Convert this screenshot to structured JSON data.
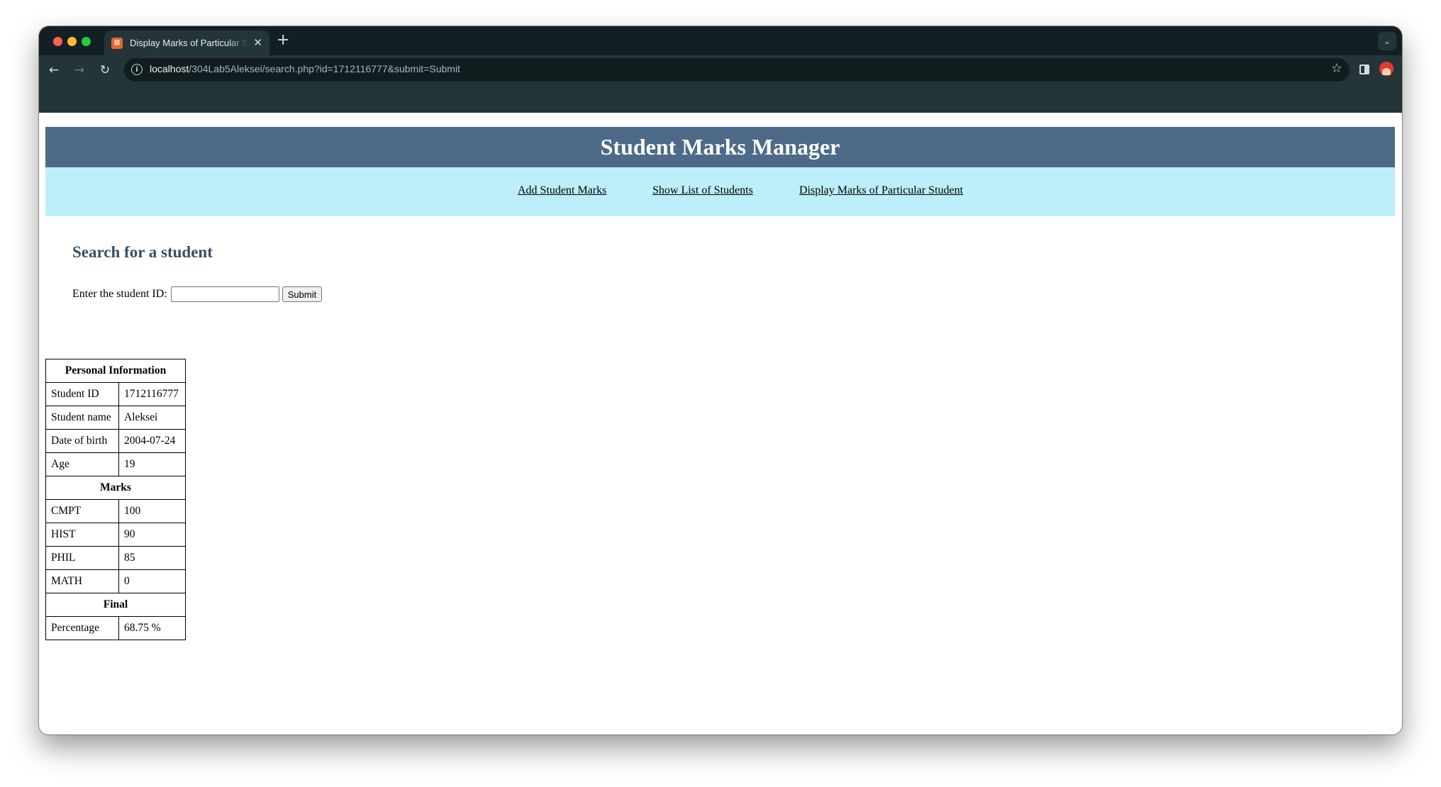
{
  "browser": {
    "tab_title": "Display Marks of Particular Student",
    "tab_favicon_glyph": "⊠",
    "url_host": "localhost",
    "url_path": "/304Lab5Aleksei/search.php?id=1712116777&submit=Submit"
  },
  "page": {
    "site_title": "Student Marks Manager",
    "nav": {
      "add": "Add Student Marks",
      "list": "Show List of Students",
      "display": "Display Marks of Particular Student"
    },
    "search": {
      "heading": "Search for a student",
      "label": "Enter the student ID:",
      "input_value": "",
      "submit_label": "Submit"
    },
    "table": {
      "personal_header": "Personal Information",
      "personal_rows": [
        {
          "label": "Student ID",
          "value": "1712116777"
        },
        {
          "label": "Student name",
          "value": "Aleksei"
        },
        {
          "label": "Date of birth",
          "value": "2004-07-24"
        },
        {
          "label": "Age",
          "value": "19"
        }
      ],
      "marks_header": "Marks",
      "marks_rows": [
        {
          "label": "CMPT",
          "value": "100"
        },
        {
          "label": "HIST",
          "value": "90"
        },
        {
          "label": "PHIL",
          "value": "85"
        },
        {
          "label": "MATH",
          "value": "0"
        }
      ],
      "final_header": "Final",
      "final_rows": [
        {
          "label": "Percentage",
          "value": "68.75 %"
        }
      ]
    }
  },
  "colors": {
    "header_bg": "#4d6a88",
    "nav_bg": "#bdeffb",
    "heading_text": "#3a4f63",
    "browser_frame": "#243538"
  }
}
